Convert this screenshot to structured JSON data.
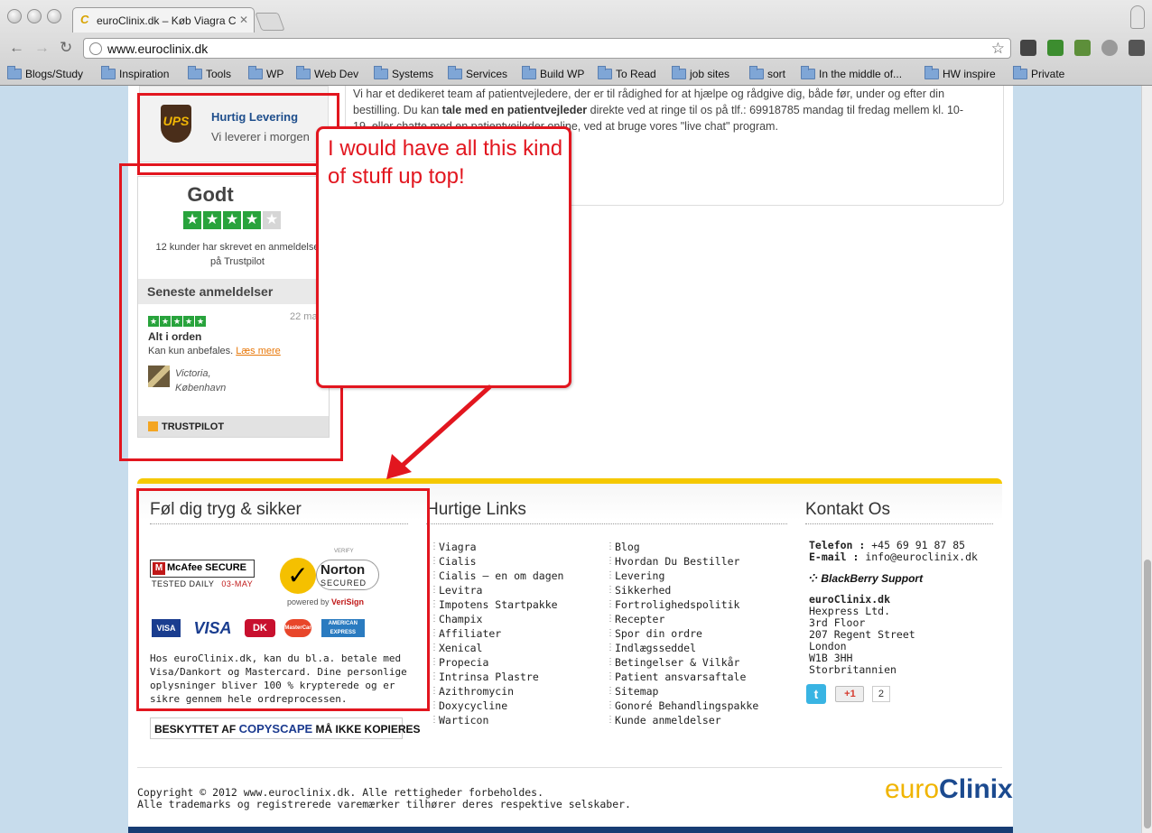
{
  "browser": {
    "tab_title": "euroClinix.dk – Køb Viagra C",
    "url": "www.euroclinix.dk",
    "bookmarks": [
      "Blogs/Study",
      "Inspiration",
      "Tools",
      "WP",
      "Web Dev",
      "Systems",
      "Services",
      "Build WP",
      "To Read",
      "job sites",
      "sort",
      "In the middle of...",
      "HW inspire",
      "Private"
    ]
  },
  "info": {
    "line1": "Vi har et dedikeret team af patientvejledere, der er til rådighed for at hjælpe og rådgive dig, både før, under og efter din",
    "line2_a": "bestilling. Du kan ",
    "line2_bold": "tale med en patientvejleder",
    "line2_b": " direkte ved at ringe til os på tlf.: 69918785 mandag til fredag mellem kl. 10-",
    "line3": "19, eller chatte med en patientvejleder online, ved at bruge vores \"live chat\" program."
  },
  "ups": {
    "logo": "UPS",
    "title": "Hurtig Levering",
    "subtitle": "Vi leverer i morgen"
  },
  "trustpilot": {
    "rating_word": "Godt",
    "stars": 4,
    "count_line1": "12 kunder har skrevet en anmeldelse",
    "count_line2": "på Trustpilot",
    "section": "Seneste anmeldelser",
    "review_date": "22 ma",
    "review_title": "Alt i orden",
    "review_text": "Kan kun anbefales. ",
    "read_more": "Læs mere",
    "author_line1": "Victoria,",
    "author_line2": "København",
    "footer": "TRUSTPILOT"
  },
  "annotation": {
    "text": "I would have all this kind of stuff up top!",
    "color": "#e2161f"
  },
  "footer": {
    "safe_title": "Føl dig tryg & sikker",
    "mcafee": "McAfee SECURE",
    "mcafee_tested": "TESTED DAILY",
    "mcafee_date": "03-MAY",
    "norton_verify": "VERIFY",
    "norton": "Norton",
    "norton_secured": "SECURED",
    "norton_powered": "powered by ",
    "norton_verisign": "VeriSign",
    "cards": [
      "VISA",
      "VISA",
      "DK",
      "MasterCard",
      "AMERICAN EXPRESS"
    ],
    "safe_text": "Hos euroClinix.dk, kan du bl.a. betale med Visa/Dankort og Mastercard. Dine personlige oplysninger bliver 100 % krypterede og er sikre gennem hele ordreprocessen.",
    "links_title": "Hurtige Links",
    "links_col1": [
      "Viagra",
      "Cialis",
      "Cialis – en om dagen",
      "Levitra",
      "Impotens Startpakke",
      "Champix",
      "Affiliater",
      "Xenical",
      "Propecia",
      "Intrinsa Plastre",
      "Azithromycin",
      "Doxycycline",
      "Warticon"
    ],
    "links_col2": [
      "Blog",
      "Hvordan Du Bestiller",
      "Levering",
      "Sikkerhed",
      "Fortrolighedspolitik",
      "Recepter",
      "Spor din ordre",
      "Indlægsseddel",
      "Betingelser & Vilkår",
      "Patient ansvarsaftale",
      "Sitemap",
      "Gonoré Behandlingspakke",
      "Kunde anmeldelser"
    ],
    "contact_title": "Kontakt Os",
    "phone_label": "Telefon :",
    "phone": " +45 69 91 87 85",
    "email_label": "E-mail :",
    "email": " info@euroclinix.dk",
    "blackberry": "BlackBerry Support",
    "company": "euroClinix.dk",
    "address": [
      "Hexpress Ltd.",
      "3rd Floor",
      "207 Regent Street",
      "London",
      "W1B 3HH",
      "Storbritannien"
    ],
    "twitter": "t",
    "gplus": "+1",
    "gplus_count": "2",
    "copyscape_a": "BESKYTTET AF ",
    "copyscape_b": "COPYSCAPE",
    "copyscape_c": " MÅ IKKE KOPIERES",
    "copyright1": "Copyright © 2012 www.euroclinix.dk. Alle rettigheder forbeholdes.",
    "copyright2": "Alle trademarks og registrerede varemærker tilhører deres respektive selskaber.",
    "logo_euro": "euro",
    "logo_clinix": "Clinix"
  }
}
